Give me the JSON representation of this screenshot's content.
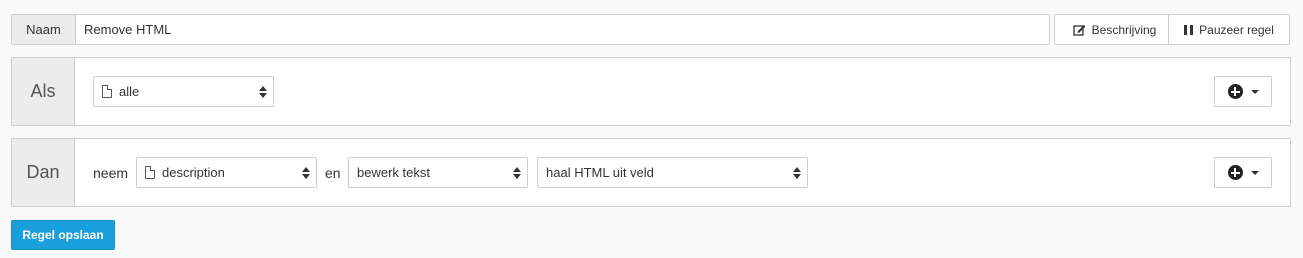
{
  "name_row": {
    "label": "Naam",
    "value": "Remove HTML",
    "description_button": "Beschrijving",
    "pause_button": "Pauzeer regel"
  },
  "als": {
    "label": "Als",
    "condition_select": "alle"
  },
  "dan": {
    "label": "Dan",
    "neem": "neem",
    "field_select": "description",
    "en": "en",
    "action_select": "bewerk tekst",
    "subaction_select": "haal HTML uit veld"
  },
  "save_button": "Regel opslaan",
  "icons": {
    "edit": "edit-icon",
    "pause": "pause-icon",
    "document": "document-icon",
    "add": "plus-circle-icon",
    "caret": "caret-down-icon"
  }
}
